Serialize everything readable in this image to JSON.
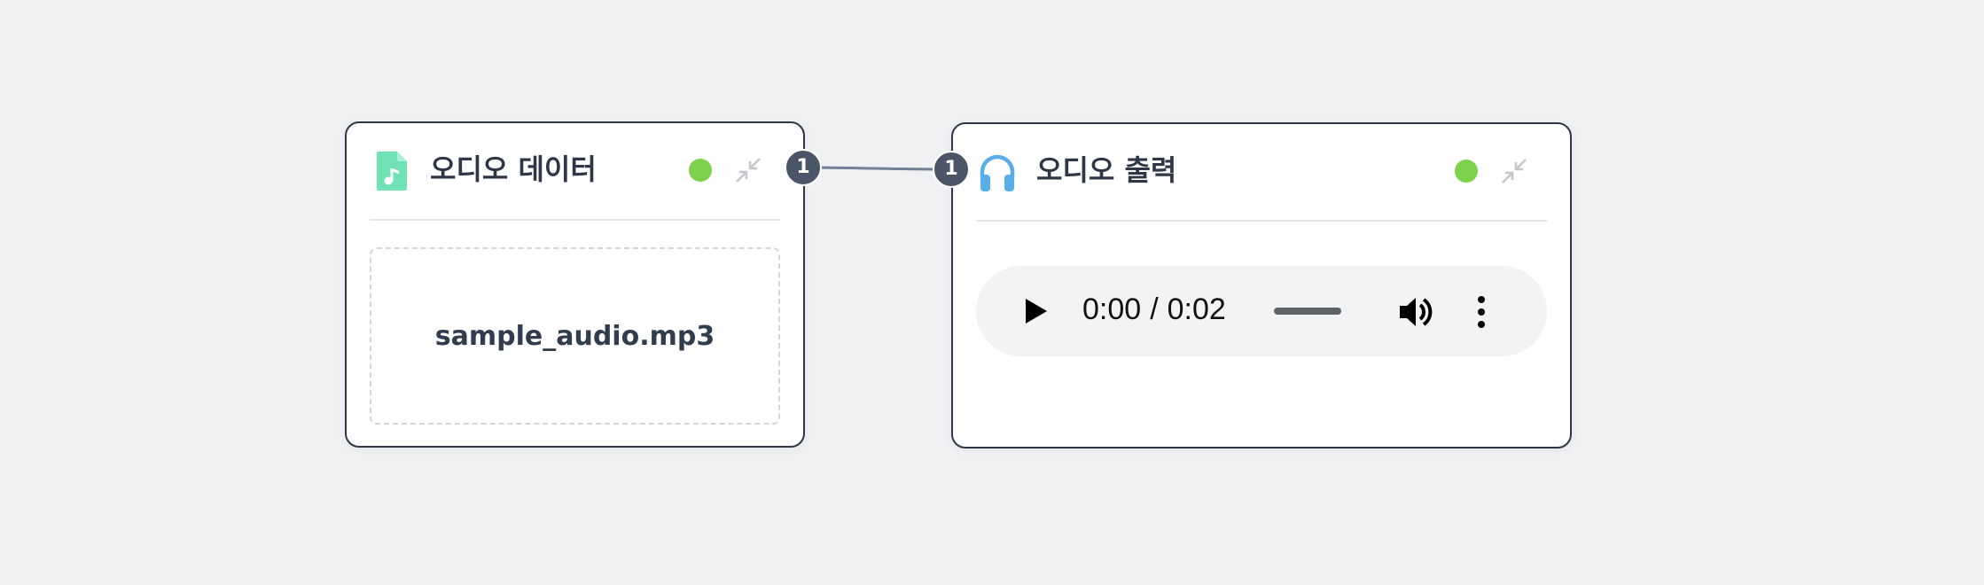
{
  "nodes": {
    "audio_data": {
      "title": "오디오 데이터",
      "icon": "audio-file-icon",
      "status": "active",
      "output_port_label": "1",
      "file_name": "sample_audio.mp3"
    },
    "audio_output": {
      "title": "오디오 출력",
      "icon": "headphones-icon",
      "status": "active",
      "input_port_label": "1",
      "player": {
        "current_time": "0:00",
        "separator": "/",
        "duration": "0:02",
        "progress": 0
      }
    }
  },
  "colors": {
    "status_active": "#7ed14a",
    "audio_file_icon": "#6fe3b5",
    "headphones_icon": "#5aaee8",
    "port": "#4a5568",
    "connector": "#718096",
    "node_border": "#2d3748"
  }
}
